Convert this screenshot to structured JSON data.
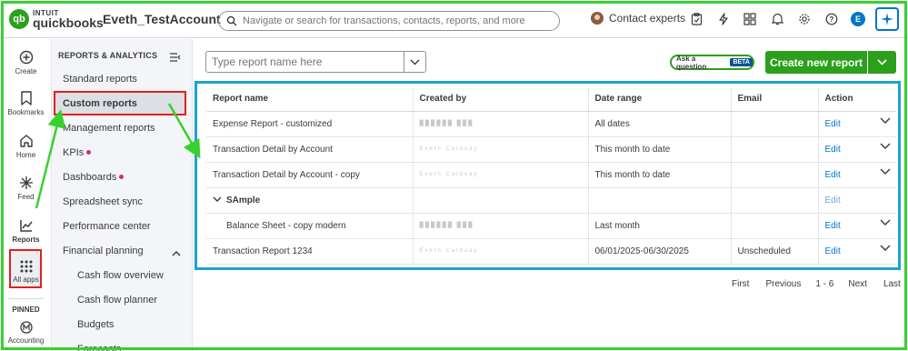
{
  "app": {
    "brand_top": "INTUIT",
    "brand_bottom": "quickbooks",
    "account_name": "Eveth_TestAccount"
  },
  "search": {
    "placeholder": "Navigate or search for transactions, contacts, reports, and more"
  },
  "header": {
    "contact_label": "Contact experts",
    "user_initial": "E"
  },
  "rail": {
    "items": [
      {
        "label": "Create",
        "icon": "plus-circle-icon"
      },
      {
        "label": "Bookmarks",
        "icon": "bookmark-icon"
      },
      {
        "label": "Home",
        "icon": "home-icon"
      },
      {
        "label": "Feed",
        "icon": "sparkle-icon"
      },
      {
        "label": "Reports",
        "icon": "bar-chart-icon"
      },
      {
        "label": "All apps",
        "icon": "grid-icon"
      }
    ],
    "pinned_label": "PINNED",
    "pinned_item": "Accounting"
  },
  "subnav": {
    "title": "REPORTS & ANALYTICS",
    "items": [
      {
        "label": "Standard reports"
      },
      {
        "label": "Custom reports"
      },
      {
        "label": "Management reports"
      },
      {
        "label": "KPIs"
      },
      {
        "label": "Dashboards"
      },
      {
        "label": "Spreadsheet sync"
      },
      {
        "label": "Performance center"
      },
      {
        "label": "Financial planning"
      },
      {
        "label": "Cash flow overview"
      },
      {
        "label": "Cash flow planner"
      },
      {
        "label": "Budgets"
      },
      {
        "label": "Forecasts"
      }
    ]
  },
  "main": {
    "report_search_placeholder": "Type report name here",
    "ask_label": "Ask a question",
    "beta_label": "BETA",
    "create_label": "Create new report",
    "columns": [
      "Report name",
      "Created by",
      "Date range",
      "Email",
      "Action"
    ],
    "rows": [
      {
        "name": "Expense Report - customized",
        "created_by": "██████ ███",
        "date_range": "All dates",
        "email": "",
        "action": "Edit"
      },
      {
        "name": "Transaction Detail by Account",
        "created_by": "Eveth Calduay",
        "date_range": "This month to date",
        "email": "",
        "action": "Edit"
      },
      {
        "name": "Transaction Detail by Account - copy",
        "created_by": "Eveth Calduay",
        "date_range": "This month to date",
        "email": "",
        "action": "Edit"
      },
      {
        "name": "SAmple",
        "created_by": "",
        "date_range": "",
        "email": "",
        "action": "Edit"
      },
      {
        "name": "Balance Sheet - copy modern",
        "created_by": "██████ ███",
        "date_range": "Last month",
        "email": "",
        "action": "Edit"
      },
      {
        "name": "Transaction Report 1234",
        "created_by": "Eveth Calduay",
        "date_range": "06/01/2025-06/30/2025",
        "email": "Unscheduled",
        "action": "Edit"
      }
    ],
    "pager": {
      "first": "First",
      "previous": "Previous",
      "range": "1 - 6",
      "next": "Next",
      "last": "Last"
    }
  },
  "colors": {
    "brand_green": "#2ca01c",
    "link_blue": "#0077c5",
    "annotation_red": "#e02020",
    "annotation_green": "#37d12f",
    "annotation_cyan": "#1ba3d1"
  }
}
